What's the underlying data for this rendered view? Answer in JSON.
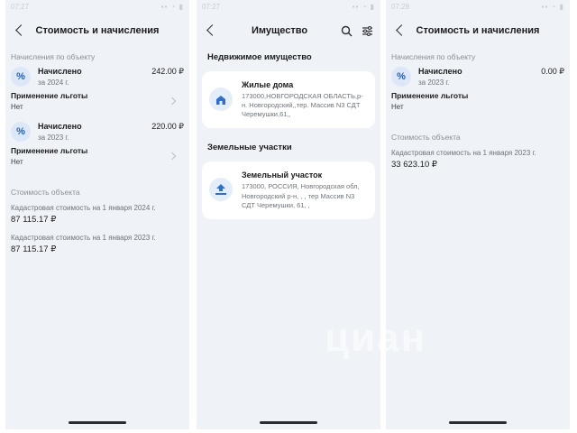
{
  "screen1": {
    "time": "07:27",
    "title": "Стоимость и начисления",
    "accruals_label": "Начисления по объекту",
    "accruals": [
      {
        "badge": "%",
        "title": "Начислено",
        "period": "за 2024 г.",
        "amount": "242.00 ₽",
        "benefit_title": "Применение льготы",
        "benefit_value": "Нет"
      },
      {
        "badge": "%",
        "title": "Начислено",
        "period": "за 2023 г.",
        "amount": "220.00 ₽",
        "benefit_title": "Применение льготы",
        "benefit_value": "Нет"
      }
    ],
    "value_label": "Стоимость объекта",
    "values": [
      {
        "label": "Кадастровая стоимость на 1 января 2024 г.",
        "value": "87 115.17 ₽"
      },
      {
        "label": "Кадастровая стоимость на 1 января 2023 г.",
        "value": "87 115.17 ₽"
      }
    ]
  },
  "screen2": {
    "time": "07:27",
    "title": "Имущество",
    "section_realty": "Недвижимое имущество",
    "realty": [
      {
        "title": "Жилые дома",
        "address": "173000,НОВГОРОДСКАЯ ОБЛАСТЬ,р-н. Новгородский,,тер. Массив N3 СДТ Черемушки,61,,"
      }
    ],
    "section_land": "Земельные участки",
    "land": [
      {
        "title": "Земельный участок",
        "address": "173000, РОССИЯ, Новгородская обл, Новгородский р-н, , , тер Массив N3 СДТ Черемушки, 61, ,"
      }
    ]
  },
  "screen3": {
    "time": "07:28",
    "title": "Стоимость и начисления",
    "accruals_label": "Начисления по объекту",
    "accruals": [
      {
        "badge": "%",
        "title": "Начислено",
        "period": "за 2023 г.",
        "amount": "0.00 ₽",
        "benefit_title": "Применение льготы",
        "benefit_value": "Нет"
      }
    ],
    "value_label": "Стоимость объекта",
    "values": [
      {
        "label": "Кадастровая стоимость на 1 января 2023 г.",
        "value": "33 623.10 ₽"
      }
    ]
  },
  "watermark": "циан",
  "colors": {
    "background": "#eff2f6",
    "accent": "#1f5fbf",
    "badge_bg": "#dce8f8"
  },
  "icons": [
    "back-chevron-icon",
    "search-icon",
    "filter-icon",
    "percent-icon",
    "house-icon",
    "land-plot-icon",
    "chevron-right-icon"
  ]
}
